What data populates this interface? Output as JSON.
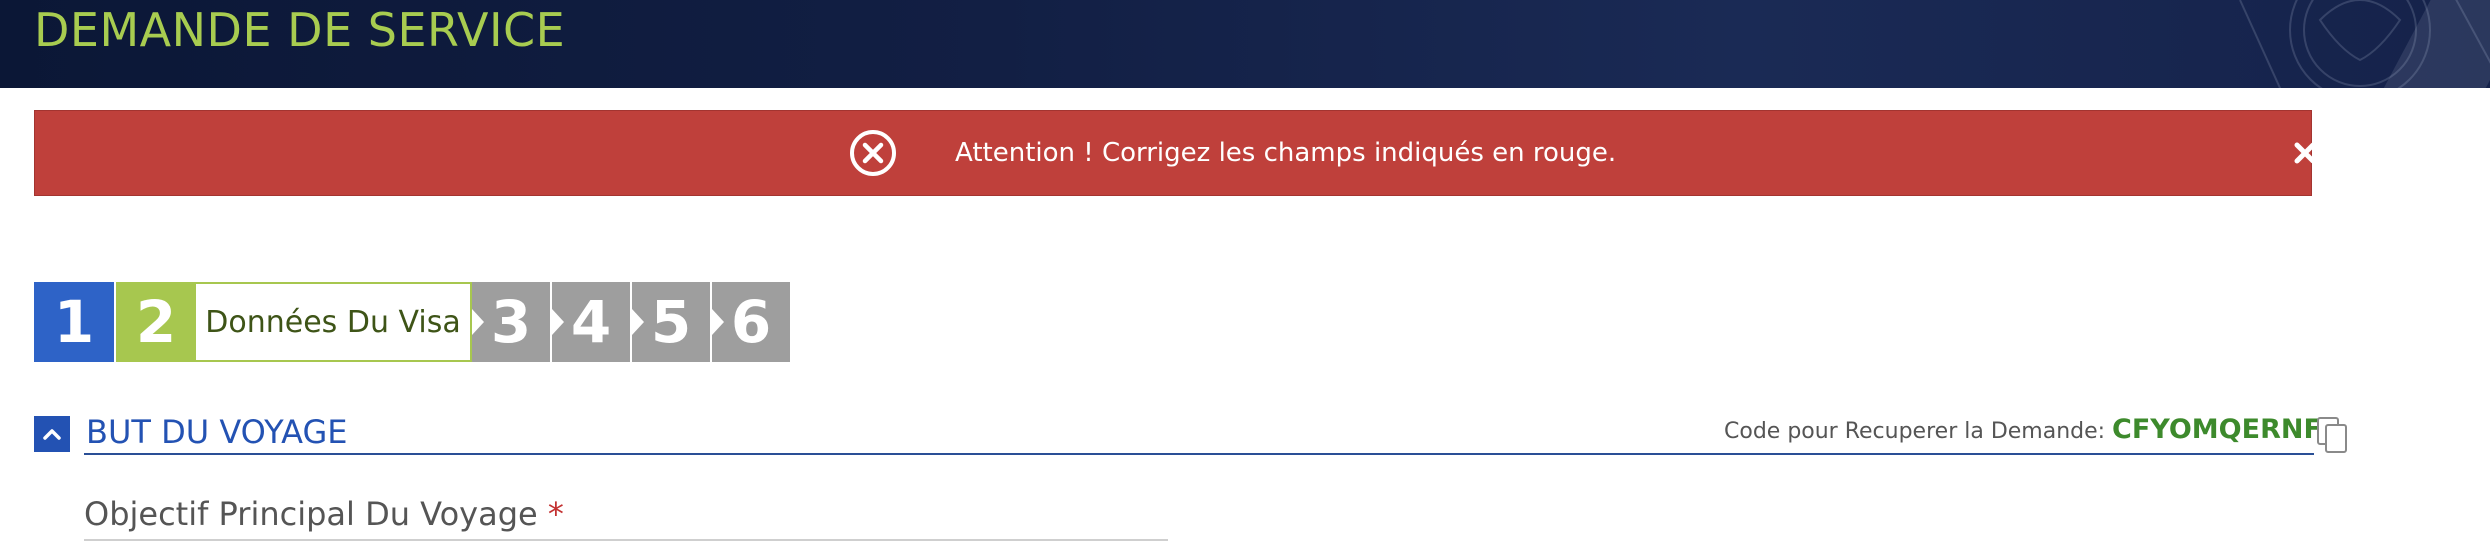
{
  "header": {
    "title": "DEMANDE DE SERVICE",
    "emblem_icon": "passport-emblem-icon"
  },
  "alert": {
    "message": "Attention ! Corrigez les champs indiqués en rouge.",
    "status_icon": "error-circle-icon",
    "close_icon": "close-icon",
    "color": "#bf403b"
  },
  "stepper": {
    "steps": [
      {
        "number": "1",
        "color": "#2e63c7"
      },
      {
        "number": "2",
        "color": "#a7c74f",
        "label": "Données Du Visa",
        "current": true
      },
      {
        "number": "3",
        "color": "#9e9e9e"
      },
      {
        "number": "4",
        "color": "#9e9e9e"
      },
      {
        "number": "5",
        "color": "#9e9e9e"
      },
      {
        "number": "6",
        "color": "#9e9e9e"
      }
    ]
  },
  "section": {
    "title": "BUT DU VOYAGE",
    "toggle_icon": "chevron-up-icon",
    "retrieval_label": "Code pour Recuperer la Demande:",
    "retrieval_code": "CFYOMQERNF",
    "copy_icon": "copy-icon"
  },
  "form": {
    "main_purpose_label": "Objectif Principal Du Voyage",
    "required_marker": "*"
  }
}
